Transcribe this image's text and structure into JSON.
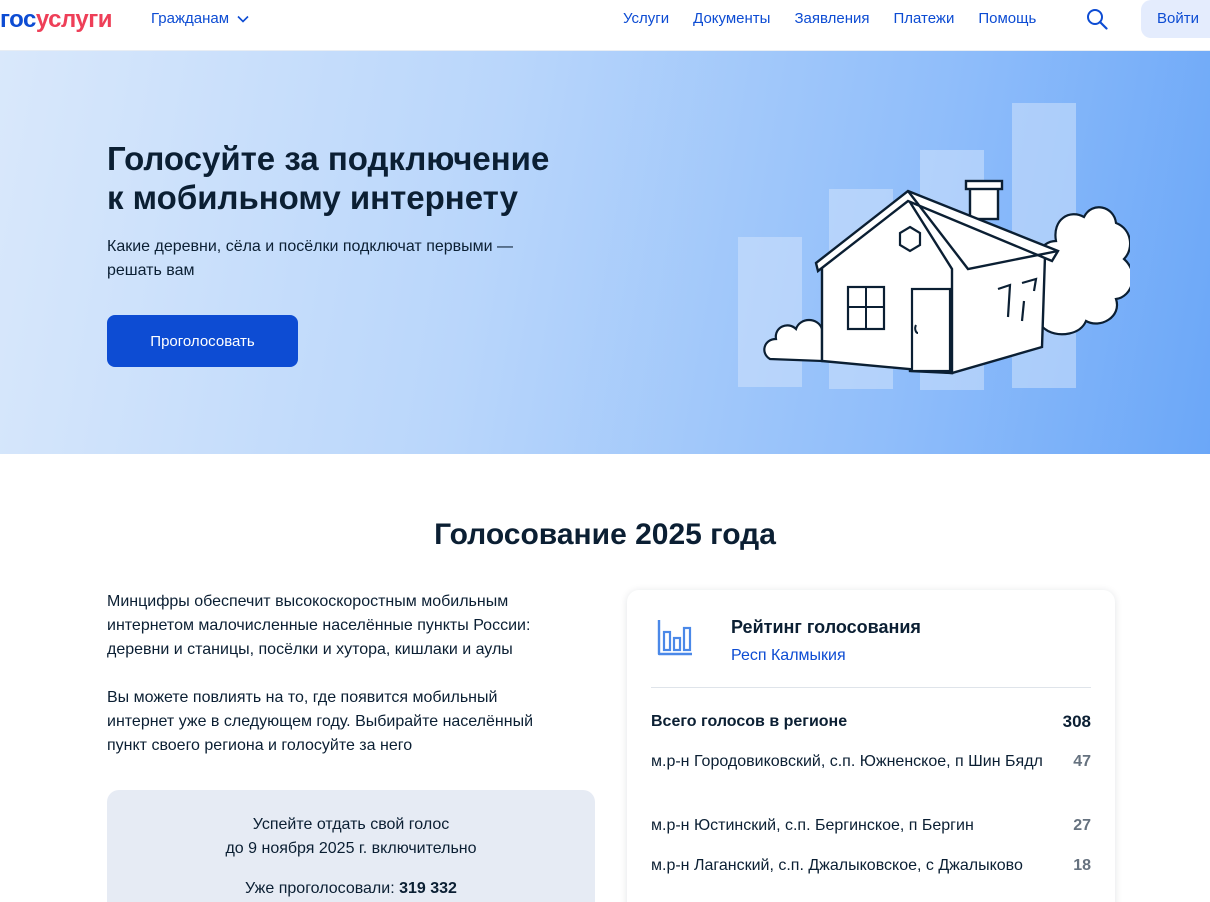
{
  "header": {
    "logo_part1": "гос",
    "logo_part2": "услуги",
    "audience": "Гражданам",
    "nav": [
      "Услуги",
      "Документы",
      "Заявления",
      "Платежи",
      "Помощь"
    ],
    "login": "Войти",
    "colors": {
      "brand_blue": "#0d4cd3",
      "brand_red": "#ee3f58"
    }
  },
  "hero": {
    "title_line1": "Голосуйте за подключение",
    "title_line2": "к мобильному интернету",
    "subtitle_line1": "Какие деревни, сёла и посёлки подключат первыми —",
    "subtitle_line2": "решать вам",
    "button": "Проголосовать"
  },
  "section": {
    "title": "Голосование 2025 года",
    "p1": [
      "Минцифры обеспечит высокоскоростным мобильным",
      "интернетом малочисленные населённые пункты России:",
      "деревни и станицы, посёлки и хутора, кишлаки и аулы"
    ],
    "p2": [
      "Вы можете повлиять на то, где появится мобильный",
      "интернет уже в следующем году. Выбирайте населённый",
      "пункт своего региона и голосуйте за него"
    ],
    "deadline_line1": "Успейте отдать свой голос",
    "deadline_line2": "до 9 ноября 2025 г. включительно",
    "voted_label": "Уже проголосовали:",
    "voted_value": "319 332"
  },
  "rating": {
    "icon": "bar-chart-icon",
    "title": "Рейтинг голосования",
    "region": "Респ Калмыкия",
    "total_label": "Всего голосов в регионе",
    "total_value": "308",
    "items": [
      {
        "name": "м.р-н Городовиковский, с.п. Южненское, п Шин Бядл",
        "votes": "47"
      },
      {
        "name": "м.р-н Юстинский, с.п. Бергинское, п Бергин",
        "votes": "27"
      },
      {
        "name": "м.р-н Лаганский, с.п. Джалыковское, с Джалыково",
        "votes": "18"
      }
    ]
  }
}
